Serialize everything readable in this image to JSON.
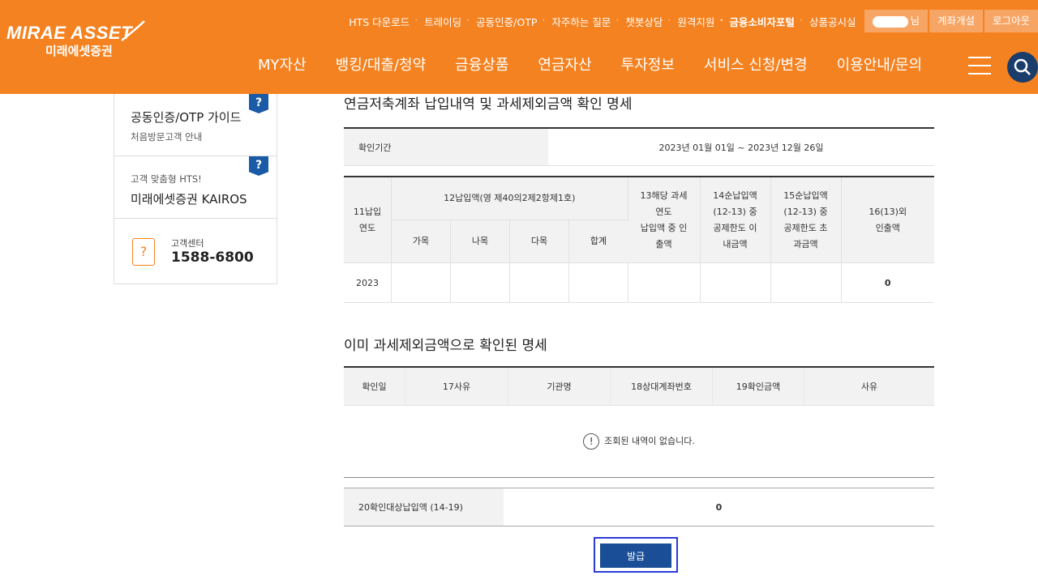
{
  "header": {
    "logo_en": "MIRAE ASSET",
    "logo_ko": "미래에셋증권",
    "util_links": [
      "HTS 다운로드",
      "트레이딩",
      "공동인증/OTP",
      "자주하는 질문",
      "챗봇상담",
      "원격지원",
      "금융소비자포털",
      "상품공시실"
    ],
    "user_suffix": "님",
    "open_account": "계좌개설",
    "logout": "로그아웃",
    "gnb": [
      "MY자산",
      "뱅킹/대출/청약",
      "금융상품",
      "연금자산",
      "투자정보",
      "서비스 신청/변경",
      "이용안내/문의"
    ],
    "brand_color": "#f58220"
  },
  "sidebar": {
    "guide_title": "공동인증/OTP 가이드",
    "guide_sub": "처음방문고객 안내",
    "hts_top": "고객 맞춤형 HTS!",
    "hts_title": "미래에셋증권 KAIROS",
    "cs_label": "고객센터",
    "cs_phone": "1588-6800",
    "q_mark": "?"
  },
  "section1": {
    "title": "연금저축계좌 납입내역 및 과세제외금액 확인 명세",
    "period_label": "확인기간",
    "period_value": "2023년 01월 01일 ~ 2023년 12월 26일"
  },
  "table2": {
    "h_year": "11납입\n연도",
    "h_pay": "12납입액(영 제40의2제2항제1호)",
    "h_sub": [
      "가목",
      "나목",
      "다목",
      "합계"
    ],
    "h13": "13해당 과세\n연도\n납입액 중 인\n출액",
    "h14": "14순납입액\n(12-13) 중\n공제한도 이\n내금액",
    "h15": "15순납입액\n(12-13) 중\n공제한도 초\n과금액",
    "h16": "16(13)외\n인출액",
    "row_year": "2023",
    "row_16": "0"
  },
  "section2": {
    "title": "이미 과세제외금액으로 확인된 명세",
    "headers": [
      "확인일",
      "17사유",
      "기관명",
      "18상대계좌번호",
      "19확인금액",
      "사유"
    ],
    "empty_msg": "조회된 내역이 없습니다.",
    "notice_icon": "!"
  },
  "summary": {
    "label": "20확인대상납입액 (14-19)",
    "value": "0"
  },
  "issue_button": "발급"
}
